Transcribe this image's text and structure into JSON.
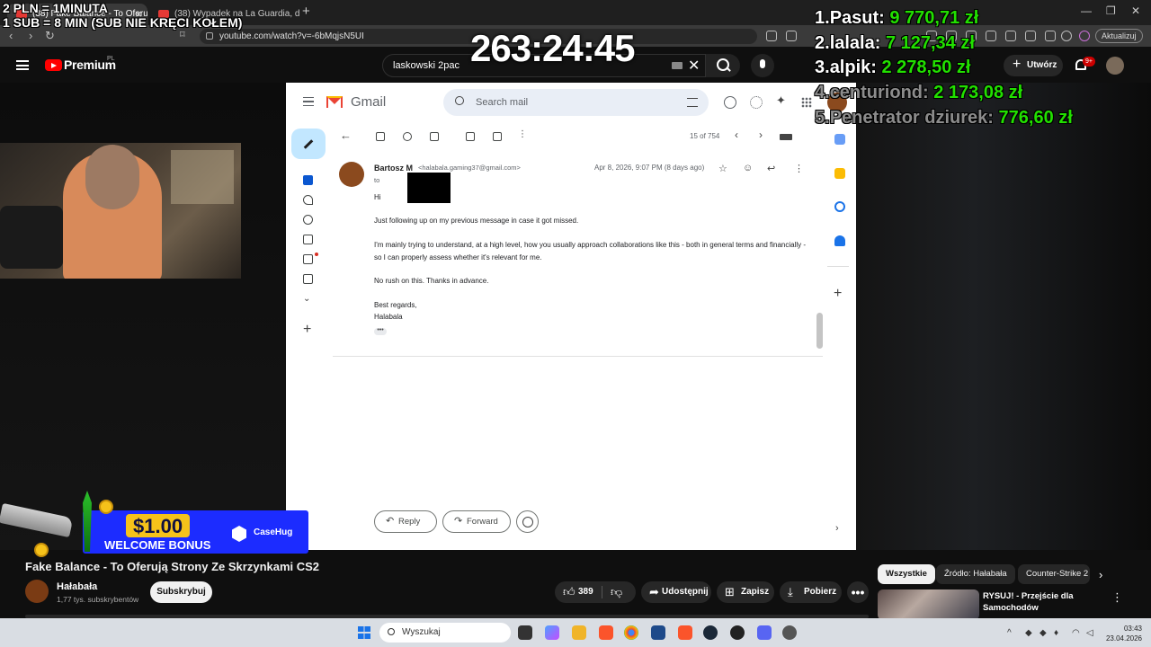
{
  "browser": {
    "tabs": [
      {
        "label": "(38) Fake Balance - To Oferu"
      },
      {
        "label": "(38) Wypadek na La Guardia, dlaczeg"
      }
    ],
    "url": "youtube.com/watch?v=-6bMqjsN5UI",
    "update_label": "Aktualizuj"
  },
  "youtube": {
    "brand": "Premium",
    "region": "PL",
    "search_query": "laskowski 2pac",
    "create_label": "Utwórz",
    "notifications_badge": "9+"
  },
  "overlay": {
    "rate_line_1": "2 PLN = 1MINUTA",
    "rate_line_2": "1 SUB = 8 MIN (SUB NIE KRĘCI KOŁEM)",
    "timer": "263:24:45",
    "leaderboard": [
      {
        "rank": "1.",
        "name": "Pasut:",
        "amount": "9 770,71 zł"
      },
      {
        "rank": "2.",
        "name": "lalala:",
        "amount": "7 127,34 zł"
      },
      {
        "rank": "3.",
        "name": "alpik:",
        "amount": "2 278,50 zł"
      },
      {
        "rank": "4.",
        "name": "centuriond:",
        "amount": "2 173,08 zł"
      },
      {
        "rank": "5.",
        "name": "Penetrator dziurek:",
        "amount": "776,60 zł"
      }
    ]
  },
  "gmail": {
    "brand": "Gmail",
    "search_placeholder": "Search mail",
    "count": "15 of 754",
    "sender_name": "Bartosz M",
    "sender_email": "<halabala.gaming37@gmail.com>",
    "to": "to",
    "date": "Apr 8, 2026, 9:07 PM (8 days ago)",
    "greeting": "Hi",
    "paragraphs": [
      "Just following up on my previous message in case it got missed.",
      "I'm mainly trying to understand, at a high level, how you usually approach collaborations like this - both in general terms and financially - so I can properly assess whether it's relevant for me.",
      "No rush on this. Thanks in advance."
    ],
    "sign_off": "Best regards,",
    "signature": "Halabala",
    "ellipsis": "•••",
    "reply_label": "Reply",
    "forward_label": "Forward"
  },
  "ad": {
    "amount": "$1.00",
    "text": "WELCOME BONUS",
    "brand": "CaseHug"
  },
  "video": {
    "title": "Fake Balance - To Oferują Strony Ze Skrzynkami CS2",
    "channel": "Hałabała",
    "subscribers": "1,77 tys. subskrybentów",
    "subscribe_label": "Subskrybuj",
    "likes": "389",
    "share_label": "Udostępnij",
    "save_label": "Zapisz",
    "download_label": "Pobierz",
    "more_label": "•••",
    "progress": 0.0
  },
  "sidebar": {
    "chips": [
      "Wszystkie",
      "Źródło: Hałabała",
      "Counter-Strike 2"
    ],
    "recommendation_title": "RYSUJ! - Przejście dla Samochodów"
  },
  "taskbar": {
    "search_placeholder": "Wyszukaj",
    "time": "03:43",
    "date": "23.04.2026"
  }
}
